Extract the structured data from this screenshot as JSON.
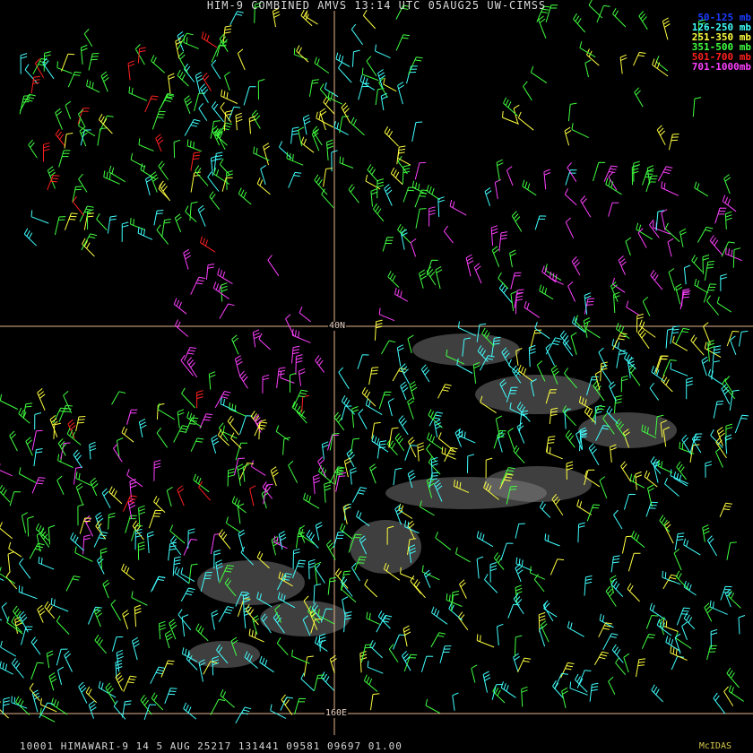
{
  "title": "HIM-9 COMBINED AMVS 13:14 UTC 05AUG25 UW-CIMSS",
  "legend": [
    {
      "label": "50-125 mb",
      "color": "#1a3cff"
    },
    {
      "label": "126-250 mb",
      "color": "#40ffff"
    },
    {
      "label": "251-350 mb",
      "color": "#ffff40"
    },
    {
      "label": "351-500 mb",
      "color": "#40ff40"
    },
    {
      "label": "501-700 mb",
      "color": "#ff2020"
    },
    {
      "label": "701-1000mb",
      "color": "#ff40ff"
    }
  ],
  "grid_labels": {
    "lat": "40N",
    "lon": "160E"
  },
  "footer": {
    "left": "10001 HIMAWARI-9 14  5 AUG 25217 131441 09581 09697 01.00",
    "right": "McIDAS"
  },
  "colors": {
    "background": "#000000",
    "gridline": "#e6b48c",
    "cloud": "#8c8c8c"
  }
}
